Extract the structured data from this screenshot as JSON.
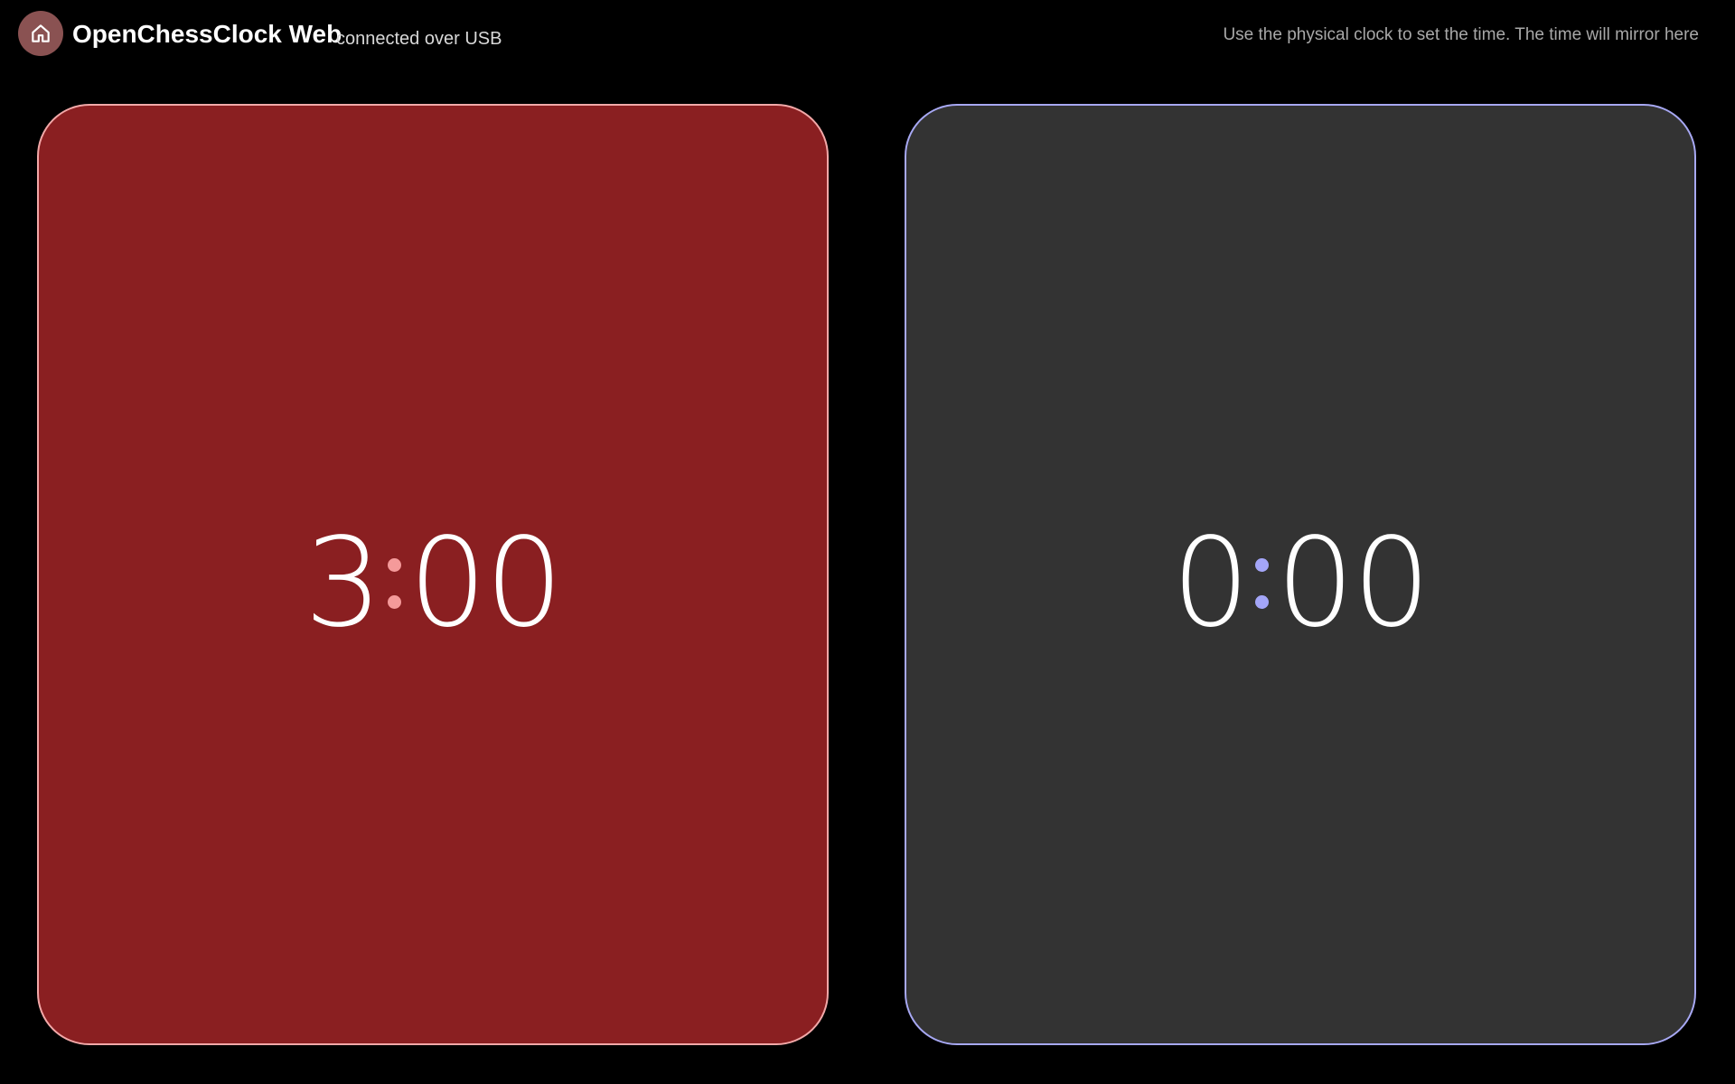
{
  "header": {
    "title": "OpenChessClock Web",
    "subtitle": "connected over USB",
    "hint": "Use the physical clock to set the time. The time will mirror here",
    "home_icon": "home-icon"
  },
  "clocks": [
    {
      "minutes": "3",
      "seconds": "00",
      "background": "#8a1f21",
      "border": "#f2a8a8",
      "accent": "#f49a9a"
    },
    {
      "minutes": "0",
      "seconds": "00",
      "background": "#333333",
      "border": "#a7a8f3",
      "accent": "#a4a6f8"
    }
  ],
  "colors": {
    "page_background": "#000000",
    "home_button": "#8a5252"
  }
}
